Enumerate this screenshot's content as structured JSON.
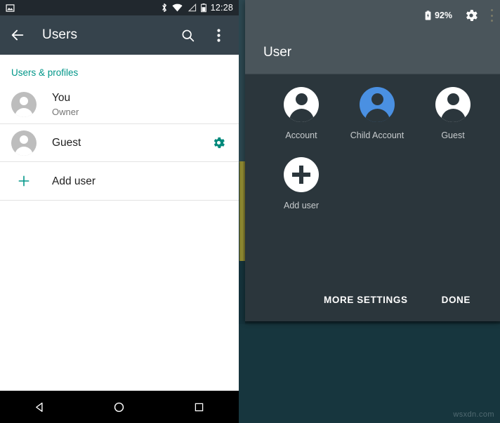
{
  "left_screen": {
    "status_bar": {
      "notification_icon": "image-icon",
      "bluetooth_icon": "bluetooth-icon",
      "wifi_icon": "wifi-icon",
      "signal_icon": "signal-icon",
      "battery_icon": "battery-icon",
      "clock": "12:28"
    },
    "appbar": {
      "back_icon": "back-arrow-icon",
      "title": "Users",
      "search_icon": "search-icon",
      "overflow_icon": "overflow-menu-icon"
    },
    "section_title": "Users & profiles",
    "rows": [
      {
        "title": "You",
        "subtitle": "Owner",
        "icon": "account-avatar-icon",
        "action": null
      },
      {
        "title": "Guest",
        "subtitle": "",
        "icon": "account-avatar-icon",
        "action": "settings-gear-icon"
      },
      {
        "title": "Add user",
        "subtitle": "",
        "icon": "plus-icon",
        "action": null
      }
    ],
    "navbar": {
      "back": "nav-back-triangle-icon",
      "home": "nav-home-circle-icon",
      "recents": "nav-recents-square-icon"
    }
  },
  "right_screen": {
    "status_bar": {
      "battery_icon": "battery-charging-icon",
      "battery_level": "92%",
      "gear_icon": "settings-gear-icon",
      "overflow_icon": "overflow-menu-icon"
    },
    "header_title": "User",
    "users": [
      {
        "label": "Account",
        "icon": "account-avatar-icon",
        "highlighted": false
      },
      {
        "label": "Child Account",
        "icon": "account-avatar-icon",
        "highlighted": true
      },
      {
        "label": "Guest",
        "icon": "account-avatar-icon",
        "highlighted": false
      },
      {
        "label": "Add user",
        "icon": "plus-circle-icon",
        "highlighted": false
      }
    ],
    "buttons": {
      "more_settings": "MORE SETTINGS",
      "done": "DONE"
    }
  },
  "watermark": "wsxdn.com",
  "colors": {
    "accent_teal": "#009688",
    "appbar": "#36434c",
    "status_bar": "#21282e",
    "overlay_panel": "#2b363c",
    "overlay_header": "#4a555b",
    "highlight_blue": "#4a90e2",
    "wallpaper": "#17363e"
  }
}
